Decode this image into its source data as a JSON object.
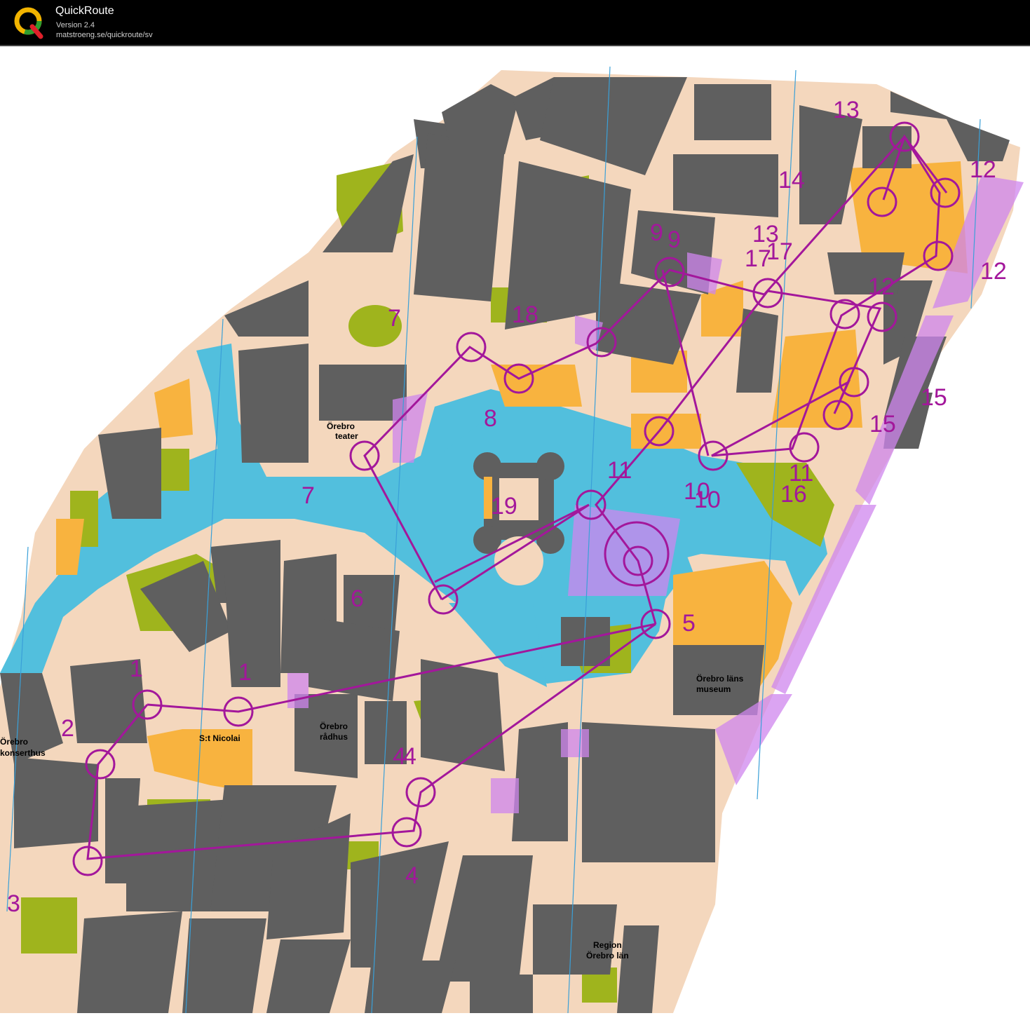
{
  "app": {
    "title": "QuickRoute",
    "version": "Version 2.4",
    "url": "matstroeng.se/quickroute/sv",
    "logo_letter": "Q"
  },
  "colors": {
    "water": "#52bfdd",
    "building": "#5f5f5f",
    "paved": "#f4d7bd",
    "green": "#9fb41d",
    "open_land": "#f8b33f",
    "course": "#a3179b",
    "restricted": "#cf86ee"
  },
  "map": {
    "place_labels": {
      "teater_1": "Örebro",
      "teater_2": "teater",
      "konserthus_1": "Örebro",
      "konserthus_2": "konserthus",
      "nicolai": "S:t Nicolai",
      "radhus_1": "Örebro",
      "radhus_2": "rådhus",
      "museum_1": "Örebro läns",
      "museum_2": "museum",
      "region_1": "Region",
      "region_2": "Örebro län"
    },
    "control_numbers": [
      "1",
      "1",
      "2",
      "3",
      "4",
      "4",
      "4",
      "5",
      "6",
      "7",
      "7",
      "8",
      "9",
      "9",
      "10",
      "10",
      "11",
      "11",
      "12",
      "12",
      "12",
      "13",
      "13",
      "14",
      "15",
      "15",
      "16",
      "17",
      "17",
      "18",
      "19"
    ]
  }
}
